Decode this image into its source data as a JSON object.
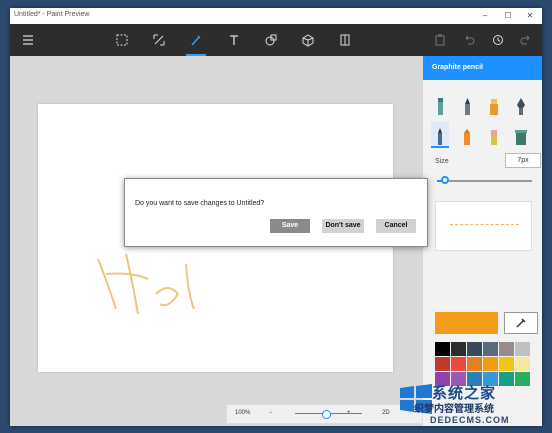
{
  "window": {
    "title": "Untitled* - Paint Preview",
    "controls": [
      "–",
      "☐",
      "✕"
    ]
  },
  "toolbar": {
    "menu_icon": "hamburger-icon",
    "center_tools": [
      "select-icon",
      "crop-icon",
      "brush-icon",
      "text-icon",
      "sticker-icon",
      "3d-object-icon",
      "canvas-icon"
    ],
    "active_tool": "brush-icon",
    "right_tools": [
      "paste-icon",
      "undo-icon",
      "history-icon",
      "redo-icon"
    ]
  },
  "panel": {
    "title": "Graphite pencil",
    "brush_tools": [
      "marker-icon",
      "pen-icon",
      "highlighter-icon",
      "calligraphy-pen-icon",
      "pencil-icon",
      "crayon-icon",
      "eraser-icon",
      "bucket-icon"
    ],
    "selected_tool": "pencil-icon",
    "size_label": "Size",
    "size_value": "7px",
    "size_level": 0.05,
    "current_color": "#f39c1c",
    "picker_icon": "eyedropper-icon",
    "swatches": [
      "#000000",
      "#2e2e2e",
      "#3a4a5a",
      "#5a6b7c",
      "#9a8a8a",
      "#c0c0c0",
      "#c0392b",
      "#e74c3c",
      "#e67e22",
      "#f39c12",
      "#f1c40f",
      "#f5e6a0",
      "#8e44ad",
      "#9b59b6",
      "#2980b9",
      "#3498db",
      "#16a085",
      "#27ae60"
    ]
  },
  "zoom": {
    "value": "100%",
    "minus": "−",
    "plus": "+",
    "mode": "2D",
    "level": 0.45
  },
  "dialog": {
    "message": "Do you want to save changes to Untitled?",
    "save_label": "Save",
    "dont_save_label": "Don't save",
    "cancel_label": "Cancel"
  },
  "watermark": {
    "line1": "系统之家",
    "line2": "织梦内容管理系统",
    "line3": "DEDECMS.COM"
  }
}
